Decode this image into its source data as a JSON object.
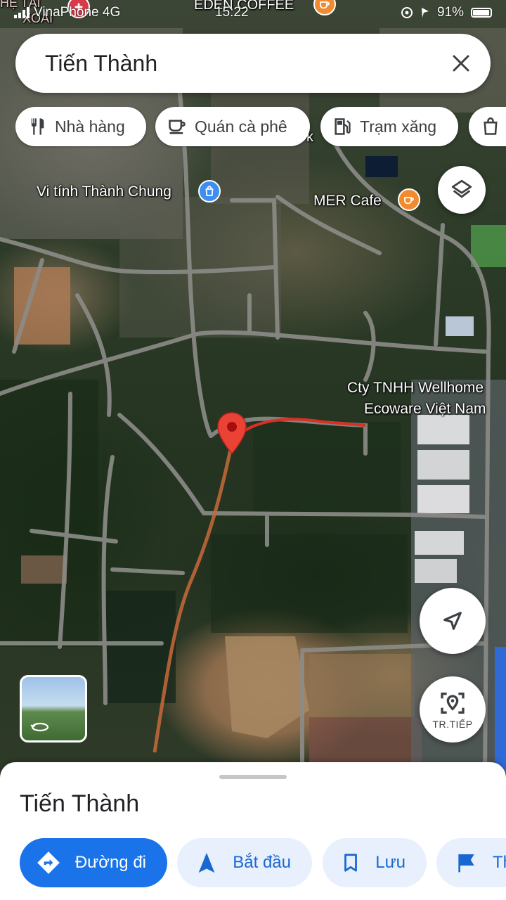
{
  "status_bar": {
    "carrier": "VinaPhone 4G",
    "time": "15:22",
    "battery": "91%"
  },
  "search": {
    "query": "Tiến Thành",
    "clear_icon": "close-icon"
  },
  "chips": [
    {
      "label": "Nhà hàng",
      "icon": "restaurant-icon"
    },
    {
      "label": "Quán cà phê",
      "icon": "coffee-icon"
    },
    {
      "label": "Trạm xăng",
      "icon": "gas-station-icon"
    },
    {
      "label": "",
      "icon": "shopping-bag-icon"
    }
  ],
  "map": {
    "top_labels": [
      "EDEN COFFEE",
      "HỆ TÀI",
      "XOÀI"
    ],
    "places": [
      {
        "name": "Vi tính Thành Chung",
        "icon": "shopping-bag-icon",
        "color": "#3c8ef0"
      },
      {
        "name": "MER Cafe",
        "icon": "coffee-icon",
        "color": "#f28b30"
      },
      {
        "name": "Cty TNHH Wellhome Ecoware Việt Nam",
        "line1": "Cty TNHH Wellhome",
        "line2": "Ecoware Việt Nam"
      }
    ],
    "marker_color": "#ea4335",
    "route_color": "#d93025",
    "partial_chip_letter": "k"
  },
  "controls": {
    "layers_icon": "layers-icon",
    "location_icon": "navigation-arrow-icon",
    "live_view_label": "TR.TIẾP"
  },
  "sheet": {
    "title": "Tiến Thành",
    "actions": [
      {
        "label": "Đường đi",
        "icon": "directions-icon",
        "style": "primary"
      },
      {
        "label": "Bắt đầu",
        "icon": "navigation-start-icon",
        "style": "secondary"
      },
      {
        "label": "Lưu",
        "icon": "bookmark-icon",
        "style": "secondary"
      },
      {
        "label": "Th",
        "icon": "flag-icon",
        "style": "secondary"
      }
    ]
  }
}
